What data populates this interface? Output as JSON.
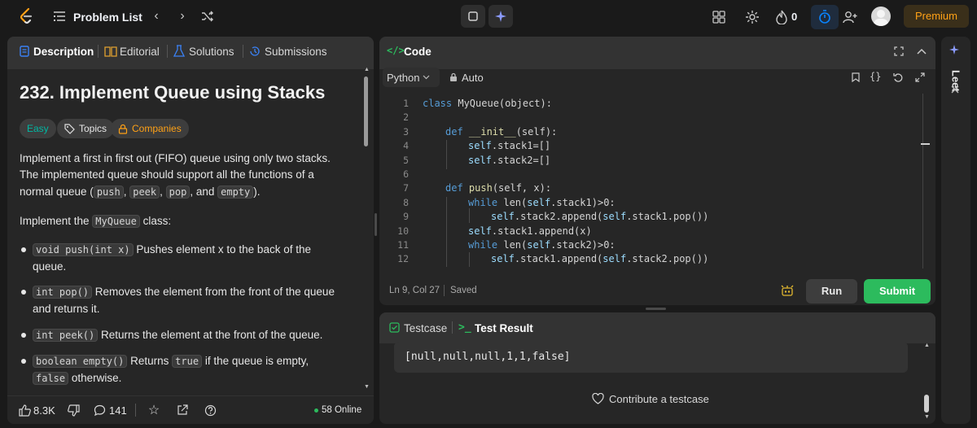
{
  "topbar": {
    "problem_list": "Problem List",
    "coins": "0",
    "premium": "Premium"
  },
  "left": {
    "tabs": [
      {
        "label": "Description"
      },
      {
        "label": "Editorial"
      },
      {
        "label": "Solutions"
      },
      {
        "label": "Submissions"
      }
    ],
    "title": "232. Implement Queue using Stacks",
    "difficulty": "Easy",
    "topics": "Topics",
    "companies": "Companies",
    "para1": {
      "line1": "Implement a first in first out (FIFO) queue using only two stacks.",
      "line2": "The implemented queue should support all the functions of a",
      "line3_pre": "normal queue (",
      "push": "push",
      "comma1": ", ",
      "peek": "peek",
      "comma2": ", ",
      "pop": "pop",
      "and": ", and ",
      "empty": "empty",
      "end": ")."
    },
    "para2_pre": "Implement the ",
    "para2_code": "MyQueue",
    "para2_post": " class:",
    "bullets": [
      {
        "code": "void push(int x)",
        "text": " Pushes element x to the back of the",
        "text2": "queue."
      },
      {
        "code": "int pop()",
        "text": " Removes the element from the front of the queue",
        "text2": "and returns it."
      },
      {
        "code": "int peek()",
        "text": " Returns the element at the front of the queue."
      },
      {
        "code": "boolean empty()",
        "text": " Returns ",
        "code2": "true",
        "text_b": " if the queue is empty,",
        "code3": "false",
        "text2": " otherwise."
      }
    ],
    "footer": {
      "likes": "8.3K",
      "comments": "141",
      "online": "58 Online"
    }
  },
  "code": {
    "header": "Code",
    "language": "Python",
    "auto": "Auto",
    "lines": [
      {
        "n": "1",
        "tokens": [
          [
            "kw",
            "class "
          ],
          [
            "txt",
            "MyQueue(object):"
          ]
        ]
      },
      {
        "n": "2",
        "tokens": []
      },
      {
        "n": "3",
        "tokens": [
          [
            "kw",
            "def "
          ],
          [
            "fn",
            "__init__"
          ],
          [
            "txt",
            "(self):"
          ]
        ]
      },
      {
        "n": "4",
        "tokens": [
          [
            "self",
            "self"
          ],
          [
            "txt",
            ".stack1=[]"
          ]
        ]
      },
      {
        "n": "5",
        "tokens": [
          [
            "self",
            "self"
          ],
          [
            "txt",
            ".stack2=[]"
          ]
        ]
      },
      {
        "n": "6",
        "tokens": []
      },
      {
        "n": "7",
        "tokens": [
          [
            "kw",
            "def "
          ],
          [
            "fn",
            "push"
          ],
          [
            "txt",
            "(self, x):"
          ]
        ]
      },
      {
        "n": "8",
        "tokens": [
          [
            "kw",
            "while "
          ],
          [
            "txt",
            "len("
          ],
          [
            "self",
            "self"
          ],
          [
            "txt",
            ".stack1)>0:"
          ]
        ]
      },
      {
        "n": "9",
        "tokens": [
          [
            "self",
            "self"
          ],
          [
            "txt",
            ".stack2.append("
          ],
          [
            "self",
            "self"
          ],
          [
            "txt",
            ".stack1.pop())"
          ]
        ]
      },
      {
        "n": "10",
        "tokens": [
          [
            "self",
            "self"
          ],
          [
            "txt",
            ".stack1.append(x)"
          ]
        ]
      },
      {
        "n": "11",
        "tokens": [
          [
            "kw",
            "while "
          ],
          [
            "txt",
            "len("
          ],
          [
            "self",
            "self"
          ],
          [
            "txt",
            ".stack2)>0:"
          ]
        ]
      },
      {
        "n": "12",
        "tokens": [
          [
            "self",
            "self"
          ],
          [
            "txt",
            ".stack1.append("
          ],
          [
            "self",
            "self"
          ],
          [
            "txt",
            ".stack2.pop())"
          ]
        ]
      }
    ],
    "status_pos": "Ln 9, Col 27",
    "status_saved": "Saved",
    "run": "Run",
    "submit": "Submit"
  },
  "result": {
    "tab_testcase": "Testcase",
    "tab_result": "Test Result",
    "output": "[null,null,null,1,1,false]",
    "contribute": "Contribute a testcase"
  },
  "side": {
    "leet": "Leet"
  },
  "colors": {
    "accent_green": "#2cbb5d",
    "easy": "#00b8a3",
    "premium": "#ffa116",
    "blue": "#0a84ff"
  }
}
